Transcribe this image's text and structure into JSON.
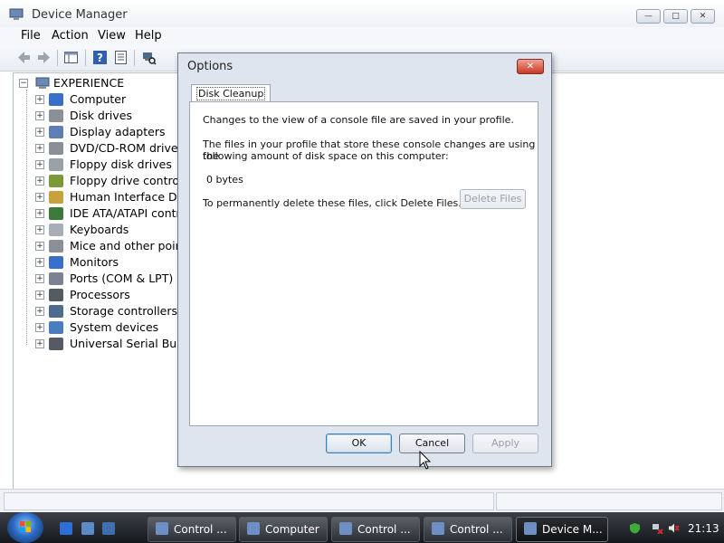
{
  "window": {
    "title": "Device Manager",
    "buttons": {
      "minimize": "—",
      "maximize": "□",
      "close": "✕"
    }
  },
  "menu": [
    "File",
    "Action",
    "View",
    "Help"
  ],
  "tree": {
    "root": "EXPERIENCE",
    "items": [
      {
        "label": "Computer",
        "icon": "computer-icon",
        "color": "#3a6fc9"
      },
      {
        "label": "Disk drives",
        "icon": "disk-drive-icon",
        "color": "#8a8f98"
      },
      {
        "label": "Display adapters",
        "icon": "display-adapter-icon",
        "color": "#5d7fb3"
      },
      {
        "label": "DVD/CD-ROM drives",
        "icon": "dvd-drive-icon",
        "color": "#8a8f98"
      },
      {
        "label": "Floppy disk drives",
        "icon": "floppy-disk-icon",
        "color": "#9aa0a8"
      },
      {
        "label": "Floppy drive controllers",
        "icon": "floppy-controller-icon",
        "color": "#7a9a3a"
      },
      {
        "label": "Human Interface Devices",
        "icon": "hid-icon",
        "color": "#c7a23a"
      },
      {
        "label": "IDE ATA/ATAPI controllers",
        "icon": "ide-controller-icon",
        "color": "#3c7a3c"
      },
      {
        "label": "Keyboards",
        "icon": "keyboard-icon",
        "color": "#a9aeb6"
      },
      {
        "label": "Mice and other pointing devices",
        "icon": "mouse-icon",
        "color": "#8a8f98"
      },
      {
        "label": "Monitors",
        "icon": "monitor-icon",
        "color": "#3a6fc9"
      },
      {
        "label": "Ports (COM & LPT)",
        "icon": "port-icon",
        "color": "#7c8390"
      },
      {
        "label": "Processors",
        "icon": "processor-icon",
        "color": "#555b63"
      },
      {
        "label": "Storage controllers",
        "icon": "storage-controller-icon",
        "color": "#4d6a8c"
      },
      {
        "label": "System devices",
        "icon": "system-device-icon",
        "color": "#4a7dbf"
      },
      {
        "label": "Universal Serial Bus controllers",
        "icon": "usb-icon",
        "color": "#555b63"
      }
    ]
  },
  "dialog": {
    "title": "Options",
    "tab": "Disk Cleanup",
    "text1": "Changes to the view of a console file are saved in your profile.",
    "text2_line1": "The files in your profile that store these console changes are using the",
    "text2_line2": "following amount of disk space on this computer:",
    "size": "0 bytes",
    "delete_text": "To permanently delete these files, click Delete Files.",
    "delete_button": "Delete Files",
    "ok": "OK",
    "cancel": "Cancel",
    "apply": "Apply"
  },
  "taskbar": {
    "tasks": [
      {
        "label": "Control ...",
        "icon": "control-panel-icon"
      },
      {
        "label": "Computer",
        "icon": "computer-icon"
      },
      {
        "label": "Control ...",
        "icon": "control-panel-icon"
      },
      {
        "label": "Control ...",
        "icon": "control-panel-icon"
      },
      {
        "label": "Device M...",
        "icon": "device-manager-icon"
      }
    ],
    "clock": "21:13"
  }
}
